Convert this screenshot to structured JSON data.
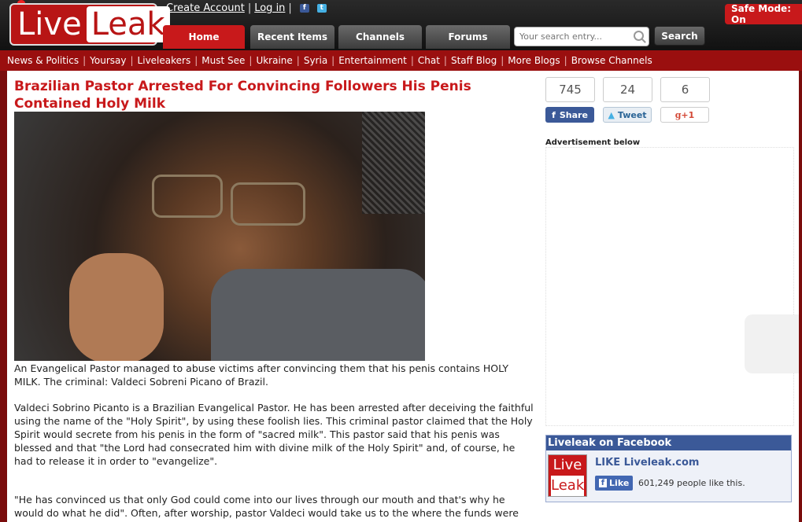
{
  "header": {
    "logo_left": "Live",
    "logo_right": "Leak",
    "top_links": [
      "Create Account",
      "Log in"
    ],
    "tabs": [
      {
        "label": "Home",
        "active": true
      },
      {
        "label": "Recent Items",
        "active": false
      },
      {
        "label": "Channels",
        "active": false
      },
      {
        "label": "Forums",
        "active": false
      }
    ],
    "search": {
      "placeholder": "Your search entry...",
      "button_label": "Search"
    },
    "safe_mode_label": "Safe Mode: On"
  },
  "nav": {
    "items": [
      "News & Politics",
      "Yoursay",
      "Liveleakers",
      "Must See",
      "Ukraine",
      "Syria",
      "Entertainment",
      "Chat",
      "Staff Blog",
      "More Blogs",
      "Browse Channels"
    ]
  },
  "article": {
    "title": "Brazilian Pastor Arrested For Convincing Followers His Penis Contained Holy Milk",
    "paragraphs": [
      "An Evangelical Pastor managed to abuse victims after convincing them that his penis contains HOLY MILK. The criminal: Valdeci Sobreni Picano of Brazil.",
      "Valdeci Sobrino Picanto is a Brazilian Evangelical Pastor. He has been arrested after deceiving the faithful using the name of the \"Holy Spirit\", by using these foolish lies. This criminal pastor claimed that the Holy Spirit would secrete from his penis in the form of \"sacred milk\". This pastor said that his penis was blessed and that \"the Lord had consecrated him with divine milk of the Holy Spirit\" and, of course, he had to release it in order to \"evangelize\".",
      "\"He has convinced us that only God could come into our lives through our mouth and that's why he would do what he did\". Often, after worship, pastor Valdeci would take us to the where the funds were"
    ]
  },
  "share": {
    "counts": [
      "745",
      "24",
      "6"
    ],
    "facebook_label": "Share",
    "twitter_label": "Tweet",
    "google_label": "+1"
  },
  "sidebar": {
    "ad_label": "Advertisement below",
    "facebook_box": {
      "title": "Liveleak on Facebook",
      "logo_top": "Live",
      "logo_bottom": "Leak",
      "like_text": "LIKE Liveleak.com",
      "like_button": "Like",
      "like_count": "601,249 people like this."
    }
  }
}
